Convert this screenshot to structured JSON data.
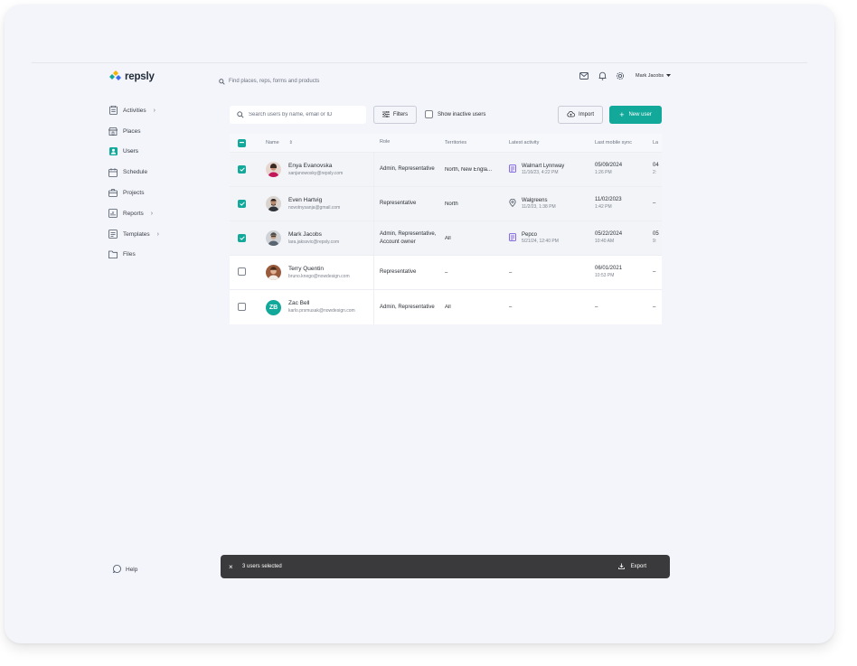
{
  "app": {
    "logo_text": "repsly"
  },
  "header": {
    "search_placeholder": "Find places, reps, forms and products",
    "user_name": "Mark Jacobs",
    "icons": [
      "mail-icon",
      "bell-icon",
      "gear-icon"
    ]
  },
  "sidebar": {
    "items": [
      {
        "label": "Activities",
        "icon": "clipboard-icon",
        "has_submenu": true
      },
      {
        "label": "Places",
        "icon": "store-icon",
        "has_submenu": false
      },
      {
        "label": "Users",
        "icon": "user-icon",
        "has_submenu": false,
        "active": true
      },
      {
        "label": "Schedule",
        "icon": "calendar-icon",
        "has_submenu": false
      },
      {
        "label": "Projects",
        "icon": "briefcase-icon",
        "has_submenu": false
      },
      {
        "label": "Reports",
        "icon": "chart-icon",
        "has_submenu": true
      },
      {
        "label": "Templates",
        "icon": "template-icon",
        "has_submenu": true
      },
      {
        "label": "Files",
        "icon": "folder-icon",
        "has_submenu": false
      }
    ],
    "help_label": "Help"
  },
  "toolbar": {
    "search_placeholder": "Search users by name, email or ID",
    "filters_label": "Filters",
    "show_inactive_label": "Show inactive users",
    "import_label": "Import",
    "new_user_label": "New user"
  },
  "table": {
    "columns": {
      "name": "Name",
      "role": "Role",
      "territories": "Territories",
      "latest_activity": "Latest activity",
      "last_sync": "Last mobile sync",
      "last": "La"
    },
    "rows": [
      {
        "selected": true,
        "name": "Enya Evanovska",
        "email": "sanjanowosky@repsly.com",
        "avatar": "photo",
        "role": "Admin, Representative",
        "territories": "North, New Engla...",
        "activity_icon": "form-icon",
        "activity_place": "Walmart Lynnway",
        "activity_time": "11/16/23, 4:22 PM",
        "sync_date": "05/09/2024",
        "sync_time": "1:26 PM",
        "last_a": "04",
        "last_b": "2:"
      },
      {
        "selected": true,
        "name": "Even Hartvig",
        "email": "novotnysanja@gmail.com",
        "avatar": "photo",
        "role": "Representative",
        "territories": "North",
        "activity_icon": "pin-icon",
        "activity_place": "Walgreens",
        "activity_time": "11/2/23, 1:38 PM",
        "sync_date": "11/02/2023",
        "sync_time": "1:42 PM",
        "last_a": "–",
        "last_b": ""
      },
      {
        "selected": true,
        "name": "Mark Jacobs",
        "email": "lara.jakssvic@repsly.com",
        "avatar": "photo",
        "role": "Admin, Representative, Account owner",
        "territories": "All",
        "activity_icon": "form-icon",
        "activity_place": "Pepco",
        "activity_time": "5/21/24, 12:40 PM",
        "sync_date": "05/22/2024",
        "sync_time": "10:40 AM",
        "last_a": "05",
        "last_b": "9:"
      },
      {
        "selected": false,
        "name": "Terry Quentin",
        "email": "bruno.knego@nowdesign.com",
        "avatar": "photo",
        "role": "Representative",
        "territories": "–",
        "activity_icon": "",
        "activity_place": "–",
        "activity_time": "",
        "sync_date": "06/01/2021",
        "sync_time": "10:53 PM",
        "last_a": "–",
        "last_b": ""
      },
      {
        "selected": false,
        "name": "Zac Bell",
        "email": "karlo.prsmusak@nowdesign.com",
        "avatar": "initials",
        "initials": "ZB",
        "role": "Admin, Representative",
        "territories": "All",
        "activity_icon": "",
        "activity_place": "–",
        "activity_time": "",
        "sync_date": "–",
        "sync_time": "",
        "last_a": "–",
        "last_b": ""
      }
    ]
  },
  "selection_bar": {
    "count_label": "3 users selected",
    "export_label": "Export"
  },
  "colors": {
    "accent": "#12a89a",
    "background": "#f4f5fa",
    "selection_bar": "#3a3a3c"
  }
}
